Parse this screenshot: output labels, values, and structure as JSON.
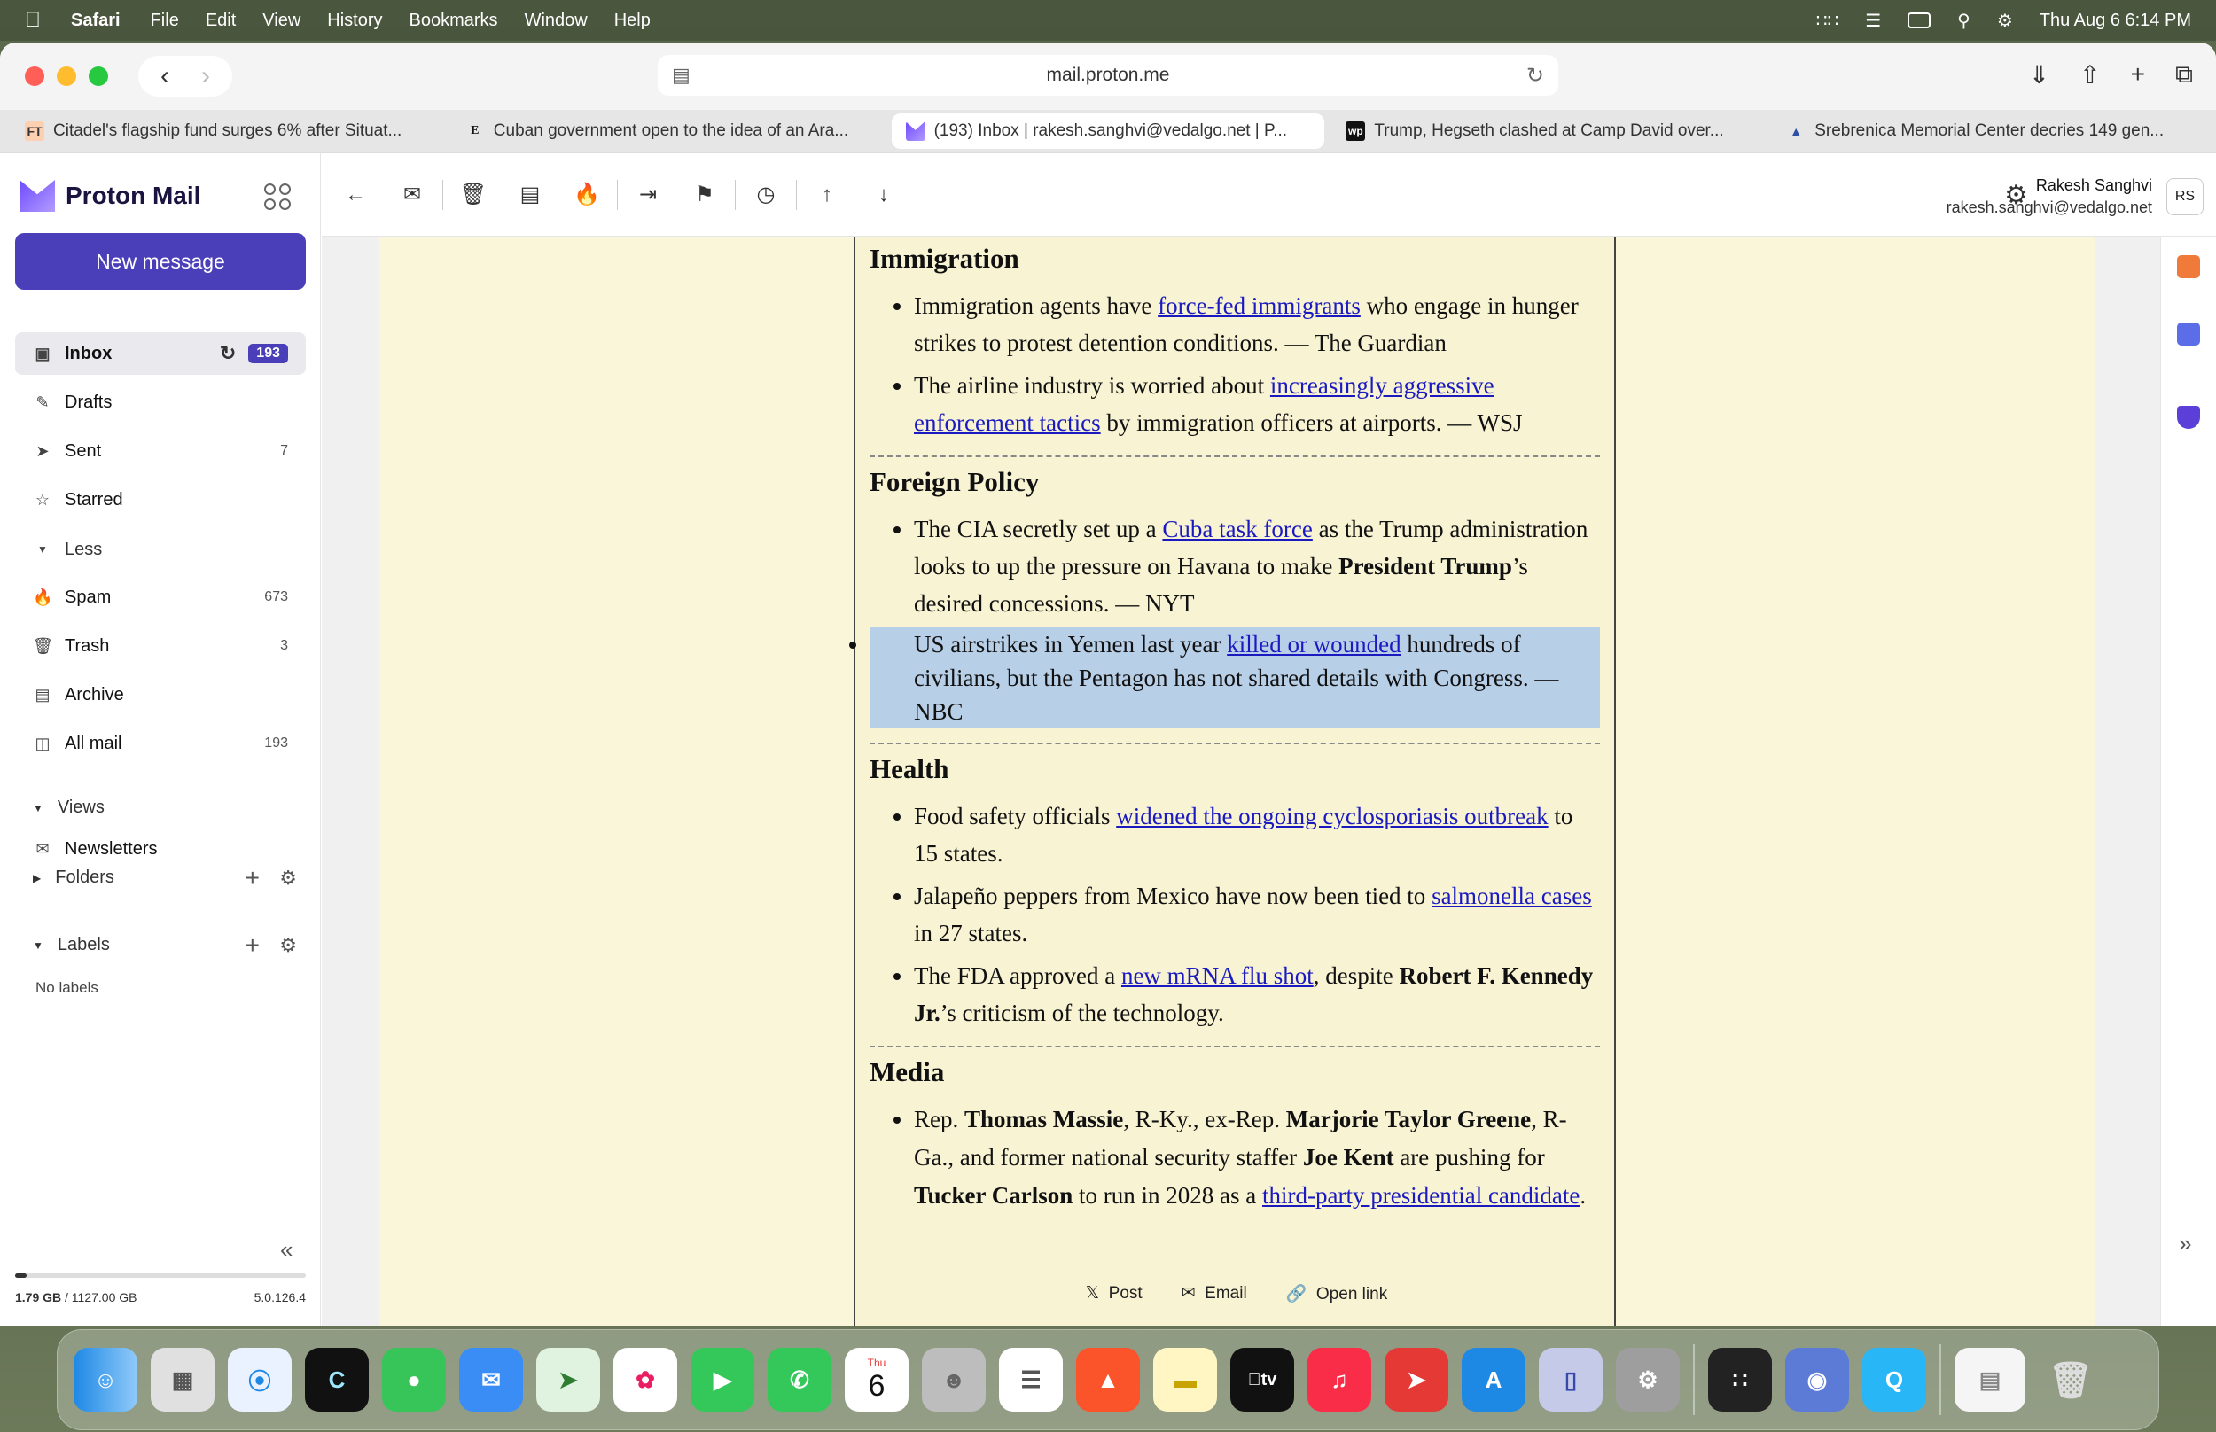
{
  "menubar": {
    "app": "Safari",
    "items": [
      "File",
      "Edit",
      "View",
      "History",
      "Bookmarks",
      "Window",
      "Help"
    ],
    "datetime": "Thu Aug 6  6:14 PM"
  },
  "browser": {
    "url": "mail.proton.me",
    "tabs": [
      {
        "favicon": "FT",
        "title": "Citadel's flagship fund surges 6% after Situat..."
      },
      {
        "favicon": "E",
        "title": "Cuban government open to the idea of an Ara..."
      },
      {
        "favicon": "proton-icon",
        "title": "(193) Inbox | rakesh.sanghvi@vedalgo.net | P..."
      },
      {
        "favicon": "wp",
        "title": "Trump, Hegseth clashed at Camp David over..."
      },
      {
        "favicon": "AA",
        "title": "Srebrenica Memorial Center decries 149 gen..."
      }
    ]
  },
  "proton": {
    "brand": "Proton Mail",
    "new_message": "New message",
    "nav": {
      "inbox": {
        "label": "Inbox",
        "count": "193"
      },
      "drafts": {
        "label": "Drafts"
      },
      "sent": {
        "label": "Sent",
        "count": "7"
      },
      "starred": {
        "label": "Starred"
      },
      "less": "Less",
      "spam": {
        "label": "Spam",
        "count": "673"
      },
      "trash": {
        "label": "Trash",
        "count": "3"
      },
      "archive": {
        "label": "Archive"
      },
      "allmail": {
        "label": "All mail",
        "count": "193"
      }
    },
    "views": "Views",
    "newsletters": "Newsletters",
    "folders": "Folders",
    "labels": "Labels",
    "no_labels": "No labels",
    "storage": {
      "used": "1.79 GB",
      "total": "/ 1127.00 GB",
      "fraction": 0.0016
    },
    "version": "5.0.126.4",
    "user": {
      "name": "Rakesh Sanghvi",
      "email": "rakesh.sanghvi@vedalgo.net",
      "initials": "RS"
    }
  },
  "email": {
    "immigration": {
      "heading": "Immigration",
      "b1": {
        "pre": "Immigration agents have ",
        "link": "force-fed immigrants",
        "post": " who engage in hunger strikes to protest detention conditions. — The Guardian"
      },
      "b2": {
        "pre": "The airline industry is worried about ",
        "link": "increasingly aggressive enforcement tactics",
        "post": " by immigration officers at airports. — WSJ"
      }
    },
    "foreign": {
      "heading": "Foreign Policy",
      "b1": {
        "pre": "The CIA secretly set up a ",
        "link": "Cuba task force",
        "mid": " as the Trump administration looks to up the pressure on Havana to make ",
        "bold": "President Trump",
        "post": "’s desired concessions. — NYT"
      },
      "b2": {
        "pre": "US airstrikes in Yemen last year ",
        "link": "killed or wounded",
        "post": " hundreds of civilians, but the Pentagon has not shared details with Congress. — NBC"
      }
    },
    "health": {
      "heading": "Health",
      "b1": {
        "pre": "Food safety officials ",
        "link": "widened the ongoing cyclosporiasis outbreak",
        "post": " to 15 states."
      },
      "b2": {
        "pre": "Jalapeño peppers from Mexico have now been tied to ",
        "link": "salmonella cases",
        "post": " in 27 states."
      },
      "b3": {
        "pre": "The FDA approved a ",
        "link": "new mRNA flu shot",
        "mid": ", despite ",
        "bold": "Robert F. Kennedy Jr.",
        "post": "’s criticism of the technology."
      }
    },
    "media": {
      "heading": "Media",
      "b1": {
        "t1": "Rep. ",
        "n1": "Thomas Massie",
        "t2": ", R-Ky., ex-Rep. ",
        "n2": "Marjorie Taylor Greene",
        "t3": ", R-Ga., and former national security staffer ",
        "n3": "Joe Kent",
        "t4": " are pushing for ",
        "n4": "Tucker Carlson",
        "t5": " to run in 2028 as a ",
        "link": "third-party presidential candidate",
        "t6": "."
      }
    },
    "share": {
      "post": "Post",
      "email": "Email",
      "open": "Open link"
    }
  },
  "dock": {
    "calendar_day": "Thu",
    "calendar_date": "6",
    "tv": "tv"
  }
}
